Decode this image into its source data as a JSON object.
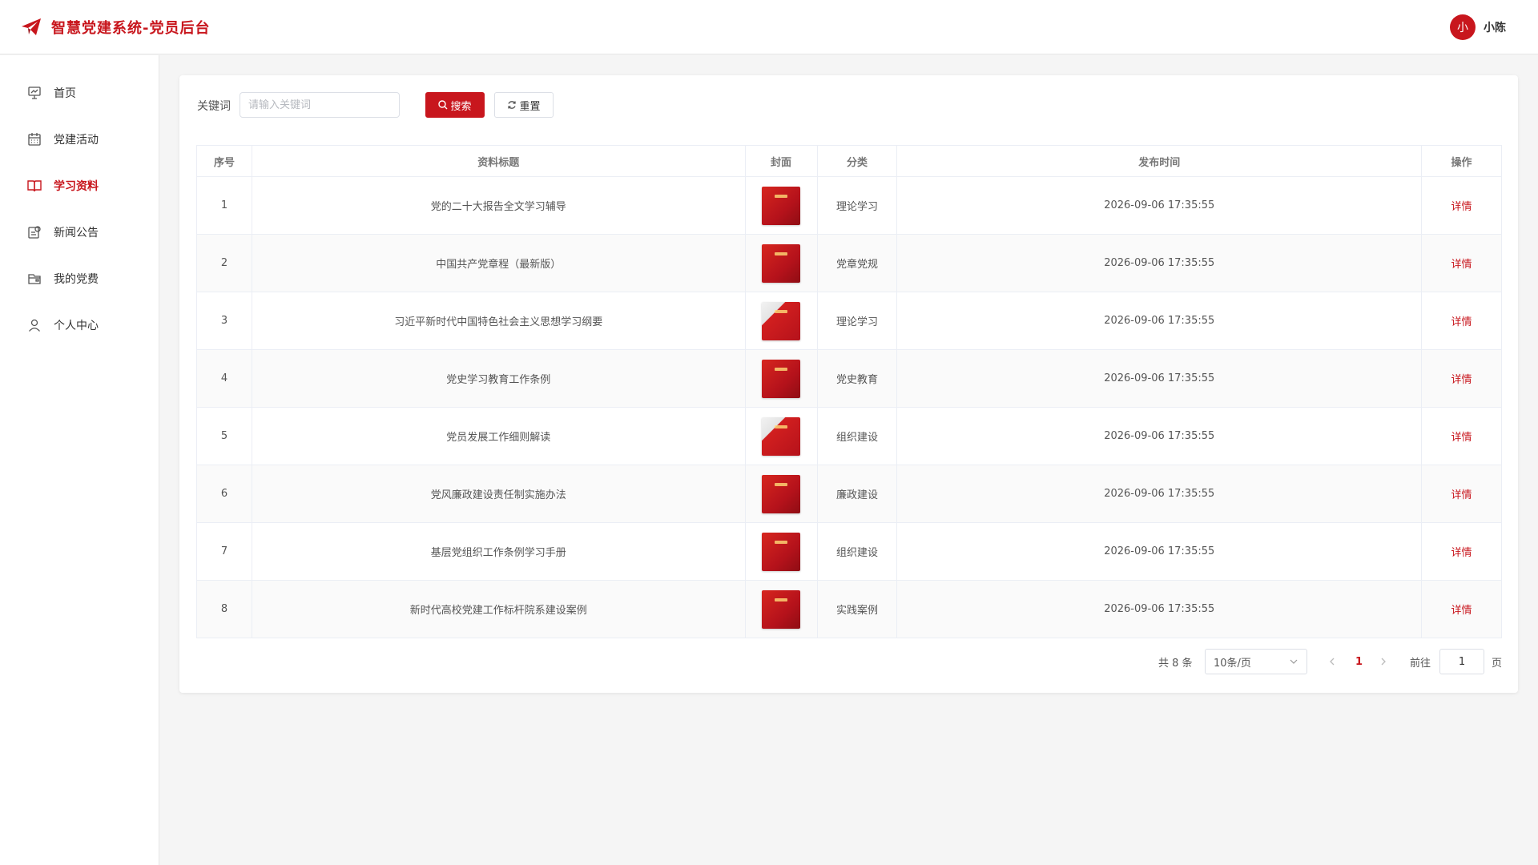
{
  "app": {
    "title": "智慧党建系统-党员后台"
  },
  "user": {
    "avatar_text": "小",
    "name": "小陈"
  },
  "colors": {
    "accent": "#c8161d"
  },
  "sidebar": {
    "items": [
      {
        "label": "首页",
        "icon": "presentation-board-icon",
        "active": false
      },
      {
        "label": "党建活动",
        "icon": "calendar-icon",
        "active": false
      },
      {
        "label": "学习资料",
        "icon": "book-icon",
        "active": true
      },
      {
        "label": "新闻公告",
        "icon": "news-icon",
        "active": false
      },
      {
        "label": "我的党费",
        "icon": "wallet-icon",
        "active": false
      },
      {
        "label": "个人中心",
        "icon": "user-icon",
        "active": false
      }
    ]
  },
  "search": {
    "label": "关键词",
    "placeholder": "请输入关键词",
    "value": "",
    "search_label": "搜索",
    "reset_label": "重置"
  },
  "table": {
    "headers": [
      "序号",
      "资料标题",
      "封面",
      "分类",
      "发布时间",
      "操作"
    ],
    "action_label": "详情",
    "rows": [
      {
        "index": "1",
        "title": "党的二十大报告全文学习辅导",
        "category": "理论学习",
        "time": "2026-09-06 17:35:55"
      },
      {
        "index": "2",
        "title": "中国共产党章程（最新版）",
        "category": "党章党规",
        "time": "2026-09-06 17:35:55"
      },
      {
        "index": "3",
        "title": "习近平新时代中国特色社会主义思想学习纲要",
        "category": "理论学习",
        "time": "2026-09-06 17:35:55"
      },
      {
        "index": "4",
        "title": "党史学习教育工作条例",
        "category": "党史教育",
        "time": "2026-09-06 17:35:55"
      },
      {
        "index": "5",
        "title": "党员发展工作细则解读",
        "category": "组织建设",
        "time": "2026-09-06 17:35:55"
      },
      {
        "index": "6",
        "title": "党风廉政建设责任制实施办法",
        "category": "廉政建设",
        "time": "2026-09-06 17:35:55"
      },
      {
        "index": "7",
        "title": "基层党组织工作条例学习手册",
        "category": "组织建设",
        "time": "2026-09-06 17:35:55"
      },
      {
        "index": "8",
        "title": "新时代高校党建工作标杆院系建设案例",
        "category": "实践案例",
        "time": "2026-09-06 17:35:55"
      }
    ]
  },
  "pagination": {
    "total_text": "共 8 条",
    "page_size": "10条/页",
    "current_page": "1",
    "goto_label": "前往",
    "goto_value": "1",
    "page_suffix": "页"
  }
}
